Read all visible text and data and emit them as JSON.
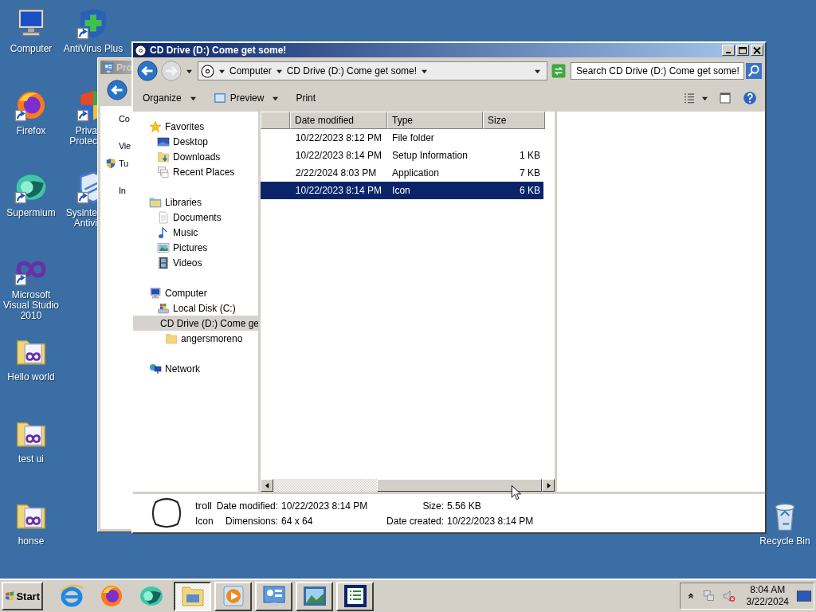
{
  "desktop": {
    "columns": [
      [
        {
          "label": "Computer",
          "kind": "computer",
          "shortcut": false
        },
        {
          "label": "Firefox",
          "kind": "firefox",
          "shortcut": true
        },
        {
          "label": "Supermium",
          "kind": "supermium",
          "shortcut": true
        },
        {
          "label": "Microsoft Visual Studio 2010",
          "kind": "vs",
          "shortcut": true
        },
        {
          "label": "Hello world",
          "kind": "vsfolder",
          "shortcut": false
        },
        {
          "label": "test ui",
          "kind": "vsfolder",
          "shortcut": false
        },
        {
          "label": "honse",
          "kind": "vsfolder",
          "shortcut": false
        }
      ],
      [
        {
          "label": "AntiVirus Plus",
          "kind": "shieldplus",
          "shortcut": true,
          "obscured": false
        },
        {
          "label": "Priva\nProtec",
          "kind": "shield",
          "shortcut": true,
          "obscured": true
        },
        {
          "label": "Sysinte\nAntivi",
          "kind": "shieldblue",
          "shortcut": true,
          "obscured": true
        }
      ]
    ],
    "recycle_bin": {
      "label": "Recycle Bin"
    }
  },
  "background_window": {
    "title": "Pro",
    "items": [
      {
        "label": "Co",
        "kind": "link"
      },
      {
        "label": "Vie",
        "kind": "link"
      },
      {
        "label": "Tu",
        "kind": "shield"
      },
      {
        "label": "In",
        "kind": "link"
      }
    ]
  },
  "window": {
    "title": "CD Drive (D:) Come get some!",
    "address": {
      "crumbs": [
        "Computer",
        "CD Drive (D:) Come get some!"
      ]
    },
    "search": {
      "placeholder": "Search CD Drive (D:) Come get some!"
    },
    "toolbar": [
      {
        "label": "Organize",
        "kind": "menu",
        "dropdown": true
      },
      {
        "label": "Preview",
        "kind": "preview",
        "dropdown": true
      },
      {
        "label": "Print",
        "kind": "menu",
        "dropdown": false
      }
    ],
    "nav": [
      {
        "label": "Favorites",
        "kind": "star",
        "selected": false,
        "children": [
          {
            "label": "Desktop",
            "kind": "desktop",
            "selected": false
          },
          {
            "label": "Downloads",
            "kind": "downloads",
            "selected": false
          },
          {
            "label": "Recent Places",
            "kind": "recent",
            "selected": false
          }
        ]
      },
      {
        "label": "Libraries",
        "kind": "library",
        "selected": false,
        "children": [
          {
            "label": "Documents",
            "kind": "document",
            "selected": false
          },
          {
            "label": "Music",
            "kind": "music",
            "selected": false
          },
          {
            "label": "Pictures",
            "kind": "pictures",
            "selected": false
          },
          {
            "label": "Videos",
            "kind": "videos",
            "selected": false
          }
        ]
      },
      {
        "label": "Computer",
        "kind": "computer",
        "selected": false,
        "children": [
          {
            "label": "Local Disk (C:)",
            "kind": "disk",
            "selected": false
          },
          {
            "label": "CD Drive (D:) Come ge",
            "kind": "cd",
            "selected": true,
            "children": [
              {
                "label": "angersmoreno",
                "kind": "folder",
                "selected": false
              }
            ]
          }
        ]
      },
      {
        "label": "Network",
        "kind": "network",
        "selected": false
      }
    ],
    "columns": [
      "Date modified",
      "Type",
      "Size"
    ],
    "files": [
      {
        "date": "10/22/2023 8:12 PM",
        "type": "File folder",
        "selected": false
      },
      {
        "date": "10/22/2023 8:14 PM",
        "type": "Setup Information",
        "size": "1 KB",
        "selected": false
      },
      {
        "date": "2/22/2024 8:03 PM",
        "type": "Application",
        "size": "7 KB",
        "selected": false
      },
      {
        "date": "10/22/2023 8:14 PM",
        "type": "Icon",
        "size": "6 KB",
        "selected": true
      }
    ],
    "details": {
      "name": "troll",
      "type": "Icon",
      "fields": [
        {
          "label": "Date modified:",
          "value": "10/22/2023 8:14 PM"
        },
        {
          "label": "Size:",
          "value": "5.56 KB"
        },
        {
          "label": "Dimensions:",
          "value": "64 x 64"
        },
        {
          "label": "Date created:",
          "value": "10/22/2023 8:14 PM"
        }
      ]
    }
  },
  "taskbar": {
    "start": "Start",
    "quick_launch": [
      {
        "kind": "ie"
      },
      {
        "kind": "firefox"
      },
      {
        "kind": "supermium"
      }
    ],
    "tasks": [
      {
        "kind": "explorer",
        "selected": true
      },
      {
        "kind": "media",
        "selected": false
      },
      {
        "kind": "control",
        "selected": false
      },
      {
        "kind": "photo",
        "selected": false
      },
      {
        "kind": "list",
        "selected": false
      }
    ],
    "clock": {
      "time": "8:04 AM",
      "date": "3/22/2024"
    }
  }
}
